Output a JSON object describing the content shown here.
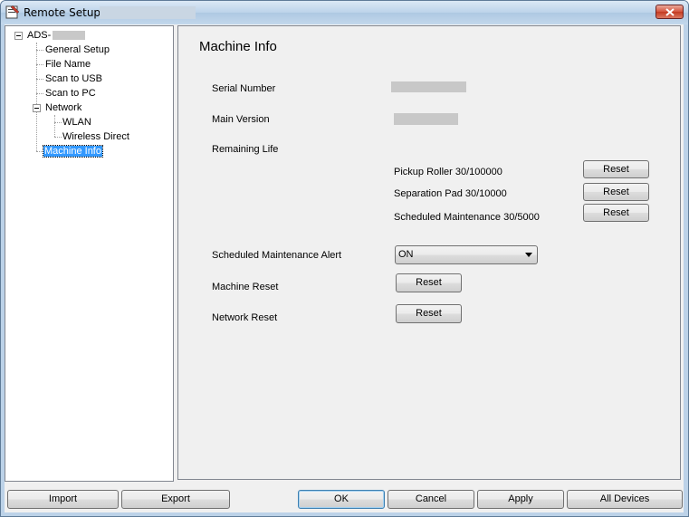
{
  "window": {
    "title": "Remote Setup -"
  },
  "tree": {
    "root": "ADS-",
    "items": [
      {
        "label": "General Setup"
      },
      {
        "label": "File Name"
      },
      {
        "label": "Scan to USB"
      },
      {
        "label": "Scan to PC"
      },
      {
        "label": "Network"
      },
      {
        "label": "WLAN"
      },
      {
        "label": "Wireless Direct"
      },
      {
        "label": "Machine Info"
      }
    ]
  },
  "panel": {
    "title": "Machine Info",
    "serial_number_label": "Serial Number",
    "main_version_label": "Main Version",
    "remaining_life_label": "Remaining Life",
    "pickup_roller": "Pickup Roller 30/100000",
    "separation_pad": "Separation Pad 30/10000",
    "scheduled_maintenance": "Scheduled Maintenance 30/5000",
    "maintenance_alert_label": "Scheduled Maintenance Alert",
    "maintenance_alert_value": "ON",
    "machine_reset_label": "Machine Reset",
    "network_reset_label": "Network Reset",
    "reset_label": "Reset"
  },
  "footer": {
    "import": "Import",
    "export": "Export",
    "ok": "OK",
    "cancel": "Cancel",
    "apply": "Apply",
    "all_devices": "All Devices"
  },
  "colors": {
    "selection": "#3399ff",
    "title_bar": "#bcd3ea",
    "close_button": "#c43a20"
  }
}
